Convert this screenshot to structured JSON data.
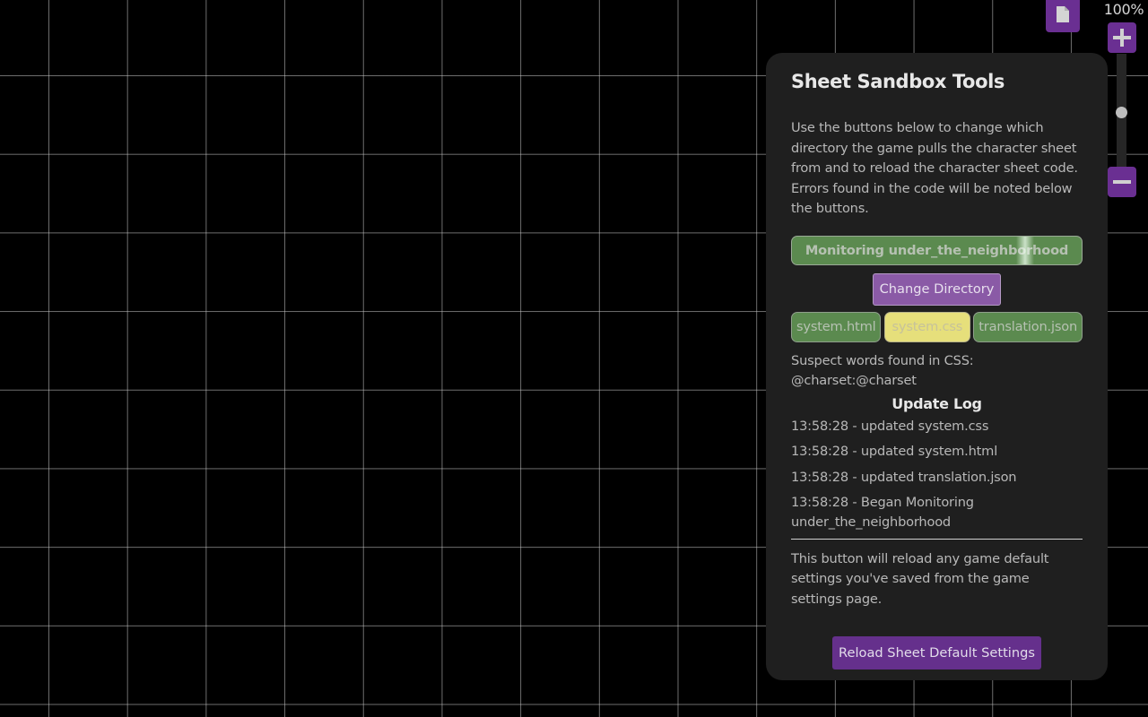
{
  "zoom": {
    "label": "100%",
    "level_fraction": 0.5,
    "zoom_in_icon": "plus-icon",
    "zoom_out_icon": "minus-icon"
  },
  "sheet_button": {
    "icon": "document-icon"
  },
  "panel": {
    "title": "Sheet Sandbox Tools",
    "intro": "Use the buttons below to change which directory the game pulls the character sheet from and to reload the character sheet code. Errors found in the code will be noted below the buttons.",
    "monitor_label": "Monitoring under_the_neighborhood",
    "change_directory_label": "Change Directory",
    "files": [
      {
        "label": "system.html",
        "status": "ok"
      },
      {
        "label": "system.css",
        "status": "warning"
      },
      {
        "label": "translation.json",
        "status": "ok"
      }
    ],
    "suspect_heading": "Suspect words found in CSS:",
    "suspect_words": "@charset:@charset",
    "log_title": "Update Log",
    "log": [
      "13:58:28 - updated system.css",
      "13:58:28 - updated system.html",
      "13:58:28 - updated translation.json",
      "13:58:28 - Began Monitoring under_the_neighborhood"
    ],
    "reload_description": "This button will reload any game default settings you've saved from the game settings page.",
    "reload_label": "Reload Sheet Default Settings"
  },
  "colors": {
    "accent_purple": "#6a2f92",
    "ok_green": "#5b8a4f",
    "warn_yellow": "#e6df7b",
    "panel_bg": "#1f1f1f"
  }
}
